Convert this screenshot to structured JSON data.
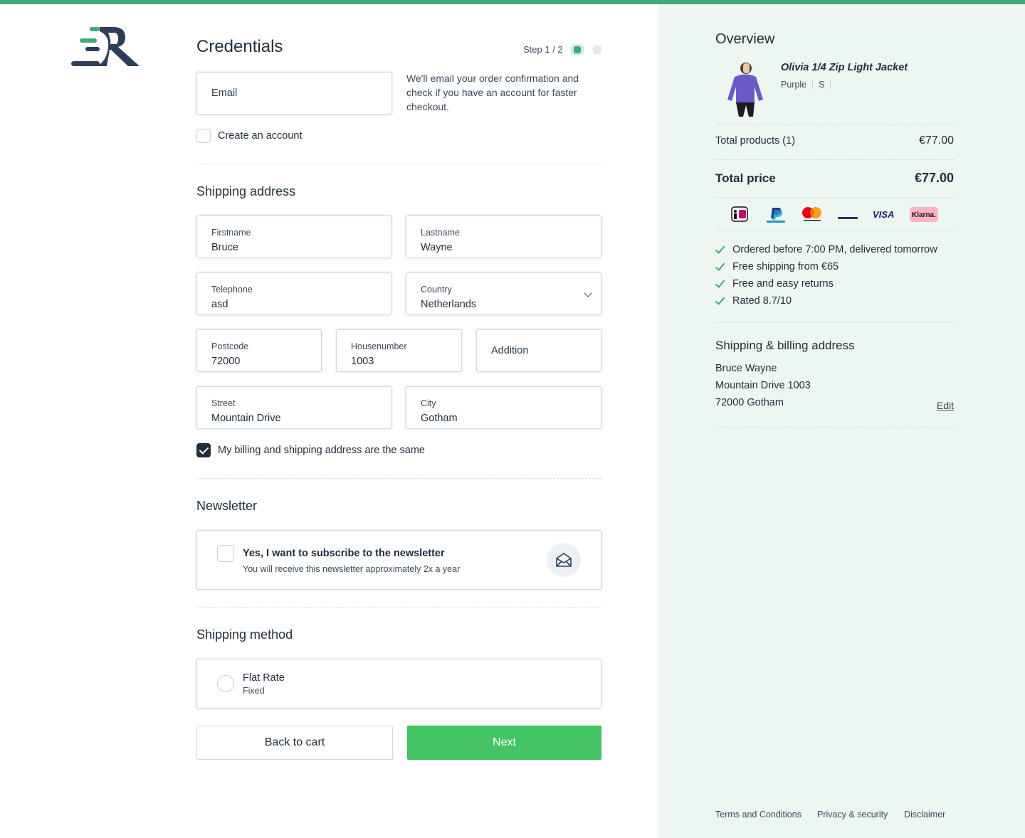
{
  "brand": {
    "accent": "#3fa97a",
    "dark": "#2c3e5a",
    "next_button_color": "#44c463"
  },
  "credentials": {
    "title": "Credentials",
    "step_label": "Step 1 / 2",
    "email_placeholder": "Email",
    "email_help": "We'll email your order confirmation and check if you have an account for faster checkout.",
    "create_account_label": "Create an account",
    "create_account_checked": false
  },
  "shipping_address": {
    "title": "Shipping address",
    "firstname": {
      "label": "Firstname",
      "value": "Bruce"
    },
    "lastname": {
      "label": "Lastname",
      "value": "Wayne"
    },
    "telephone": {
      "label": "Telephone",
      "value": "asd"
    },
    "country": {
      "label": "Country",
      "value": "Netherlands"
    },
    "postcode": {
      "label": "Postcode",
      "value": "72000"
    },
    "housenumber": {
      "label": "Housenumber",
      "value": "1003"
    },
    "addition": {
      "placeholder": "Addition"
    },
    "street": {
      "label": "Street",
      "value": "Mountain Drive"
    },
    "city": {
      "label": "City",
      "value": "Gotham"
    },
    "same_billing_label": "My billing and shipping address are the same",
    "same_billing_checked": true
  },
  "newsletter": {
    "title": "Newsletter",
    "label": "Yes, I want to subscribe to the newsletter",
    "sublabel": "You will receive this newsletter approximately 2x a year",
    "checked": false,
    "icon": "envelope-open-icon"
  },
  "shipping_method": {
    "title": "Shipping method",
    "option_label": "Flat Rate",
    "option_sub": "Fixed",
    "selected": false
  },
  "actions": {
    "back_label": "Back to cart",
    "next_label": "Next"
  },
  "overview": {
    "title": "Overview",
    "product": {
      "name": "Olivia 1/4 Zip Light Jacket",
      "color": "Purple",
      "size": "S"
    },
    "total_products_label": "Total products (1)",
    "total_products_value": "€77.00",
    "total_price_label": "Total price",
    "total_price_value": "€77.00",
    "payment_icons": [
      "ideal-icon",
      "paypal-icon",
      "mastercard-icon",
      "bancontact-icon",
      "visa-icon",
      "klarna-icon"
    ],
    "usps": [
      "Ordered before 7:00 PM, delivered tomorrow",
      "Free shipping from €65",
      "Free and easy returns",
      "Rated 8.7/10"
    ],
    "address_title": "Shipping & billing address",
    "address_lines": [
      "Bruce Wayne",
      "Mountain Drive 1003",
      "72000 Gotham"
    ],
    "edit_label": "Edit"
  },
  "footer": {
    "links": [
      "Terms and Conditions",
      "Privacy & security",
      "Disclaimer"
    ]
  }
}
